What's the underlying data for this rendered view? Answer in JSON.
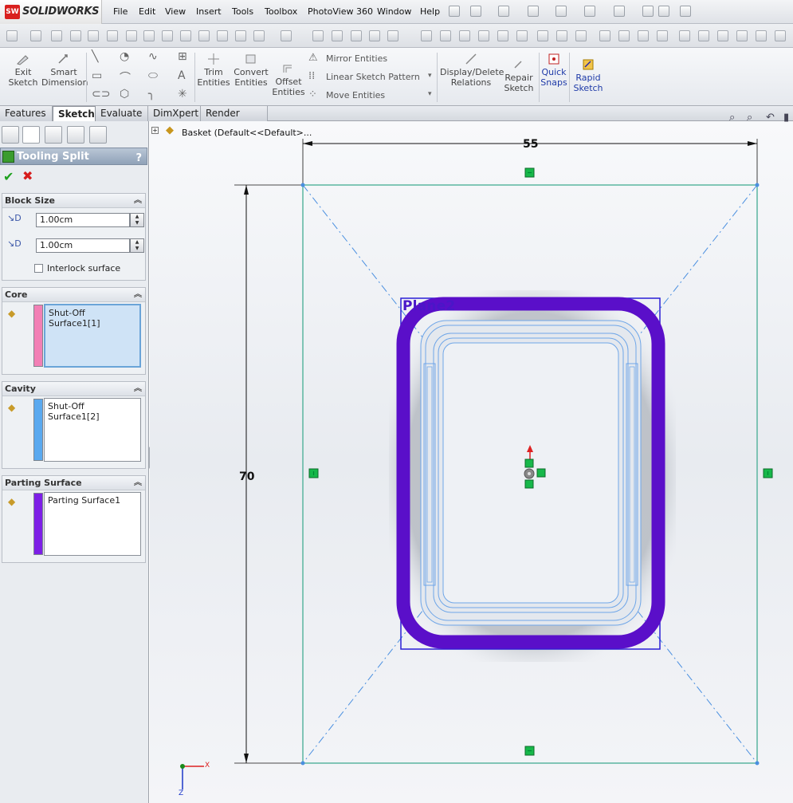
{
  "app": {
    "name": "SOLIDWORKS",
    "logo_mark": "SW"
  },
  "menu": [
    "File",
    "Edit",
    "View",
    "Insert",
    "Tools",
    "Toolbox",
    "PhotoView 360",
    "Window",
    "Help"
  ],
  "command_manager": {
    "exit_sketch": [
      "Exit",
      "Sketch"
    ],
    "smart_dimension": [
      "Smart",
      "Dimension"
    ],
    "trim_entities": [
      "Trim",
      "Entities"
    ],
    "convert_entities": [
      "Convert",
      "Entities"
    ],
    "offset_entities": [
      "Offset",
      "Entities"
    ],
    "mirror_entities": "Mirror Entities",
    "linear_sketch_pattern": "Linear Sketch Pattern",
    "move_entities": "Move Entities",
    "display_delete_relations": [
      "Display/Delete",
      "Relations"
    ],
    "repair_sketch": [
      "Repair",
      "Sketch"
    ],
    "quick_snaps": [
      "Quick",
      "Snaps"
    ],
    "rapid_sketch": [
      "Rapid",
      "Sketch"
    ]
  },
  "tabs": [
    "Features",
    "Sketch",
    "Evaluate",
    "DimXpert",
    "Render Tools"
  ],
  "active_tab": "Sketch",
  "property_manager": {
    "title": "Tooling Split",
    "help": "?",
    "block_size": {
      "header": "Block Size",
      "depth_1": "1.00cm",
      "depth_2": "1.00cm",
      "interlock_label": "Interlock surface",
      "interlock_checked": false
    },
    "core": {
      "header": "Core",
      "selection": "Shut-Off Surface1[1]",
      "color": "#f27fb5"
    },
    "cavity": {
      "header": "Cavity",
      "selection": "Shut-Off Surface1[2]",
      "color": "#5aa9ef"
    },
    "parting_surface": {
      "header": "Parting Surface",
      "selection": "Parting Surface1",
      "color": "#7d1fe6"
    }
  },
  "feature_tree": {
    "node_label": "Basket  (Default<<Default>..."
  },
  "sketch": {
    "dimension_width": "55",
    "dimension_height": "70",
    "plane_label": "Plane2",
    "sketch_color": "#5bb5a0",
    "part_color": "#5a0fc9"
  },
  "axis": {
    "x": "X",
    "z": "Z"
  },
  "icons": {
    "ok": "check-icon",
    "cancel": "x-icon",
    "collapse": "chevron-double-up-icon"
  }
}
